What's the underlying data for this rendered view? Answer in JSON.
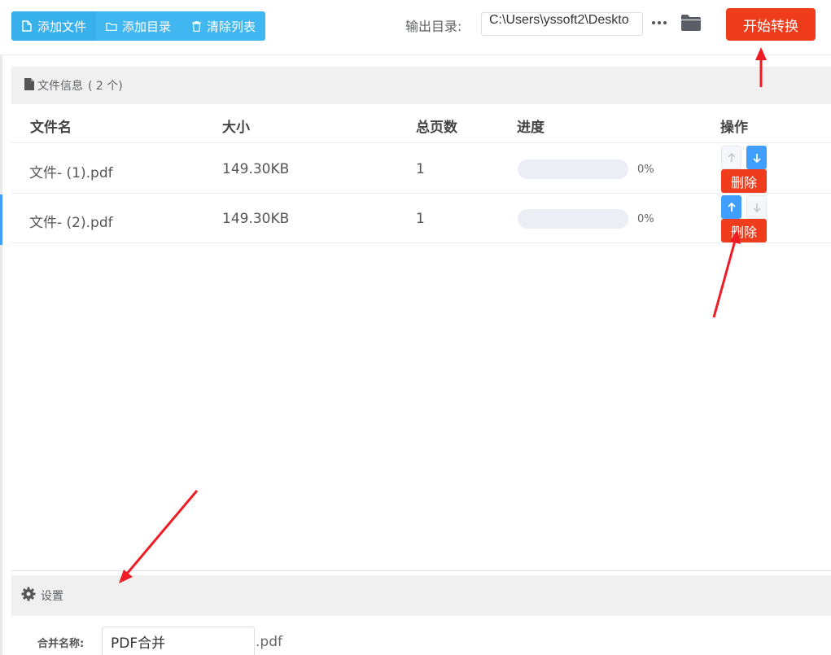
{
  "toolbar": {
    "add_file_label": "添加文件",
    "add_dir_label": "添加目录",
    "clear_list_label": "清除列表",
    "output_dir_label": "输出目录:",
    "output_dir_value": "C:\\Users\\yssoft2\\Deskto",
    "start_label": "开始转换",
    "icons": [
      "file-icon",
      "folder-outline-icon",
      "trash-icon",
      "more-dots-icon",
      "folder-icon"
    ]
  },
  "file_info": {
    "title": "文件信息",
    "count": "( 2 个)"
  },
  "table": {
    "headers": [
      "文件名",
      "大小",
      "总页数",
      "进度",
      "操作"
    ],
    "rows": [
      {
        "name": "文件- (1).pdf",
        "size": "149.30KB",
        "pages": "1",
        "progress": 0,
        "progress_text": "0%",
        "delete_label": "删除",
        "up_enabled": false,
        "down_enabled": true
      },
      {
        "name": "文件- (2).pdf",
        "size": "149.30KB",
        "pages": "1",
        "progress": 0,
        "progress_text": "0%",
        "delete_label": "删除",
        "up_enabled": true,
        "down_enabled": false
      }
    ]
  },
  "settings": {
    "title": "设置",
    "merge_name_label": "合并名称:",
    "merge_name_value": "PDF合并",
    "merge_ext": ".pdf"
  },
  "colors": {
    "toolbar_button": "#40b7f0",
    "primary": "#409eff",
    "danger": "#ef3c1d",
    "annotation_arrow": "#ee1c25"
  }
}
